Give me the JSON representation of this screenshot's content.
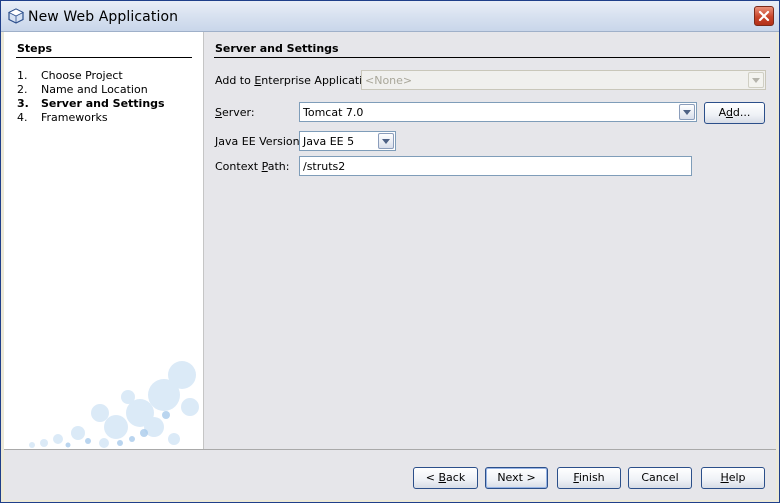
{
  "window": {
    "title": "New Web Application"
  },
  "steps": {
    "title": "Steps",
    "items": [
      {
        "num": "1.",
        "label": "Choose Project"
      },
      {
        "num": "2.",
        "label": "Name and Location"
      },
      {
        "num": "3.",
        "label": "Server and Settings"
      },
      {
        "num": "4.",
        "label": "Frameworks"
      }
    ]
  },
  "content": {
    "section_title": "Server and Settings",
    "enterprise": {
      "label_pre": "Add to ",
      "label_mn": "E",
      "label_post": "nterprise Application:",
      "value": "<None>"
    },
    "server": {
      "label_mn": "S",
      "label_post": "erver:",
      "value": "Tomcat 7.0",
      "add_pre": "A",
      "add_mn": "d",
      "add_post": "d..."
    },
    "javaee": {
      "label_mn": "J",
      "label_post": "ava EE Version:",
      "value": "Java EE 5"
    },
    "context": {
      "label_pre": "Context ",
      "label_mn": "P",
      "label_post": "ath:",
      "value": "/struts2"
    }
  },
  "footer": {
    "back_pre": "< ",
    "back_mn": "B",
    "back_post": "ack",
    "next": "Next >",
    "finish_mn": "F",
    "finish_post": "inish",
    "cancel": "Cancel",
    "help_mn": "H",
    "help_post": "elp"
  }
}
